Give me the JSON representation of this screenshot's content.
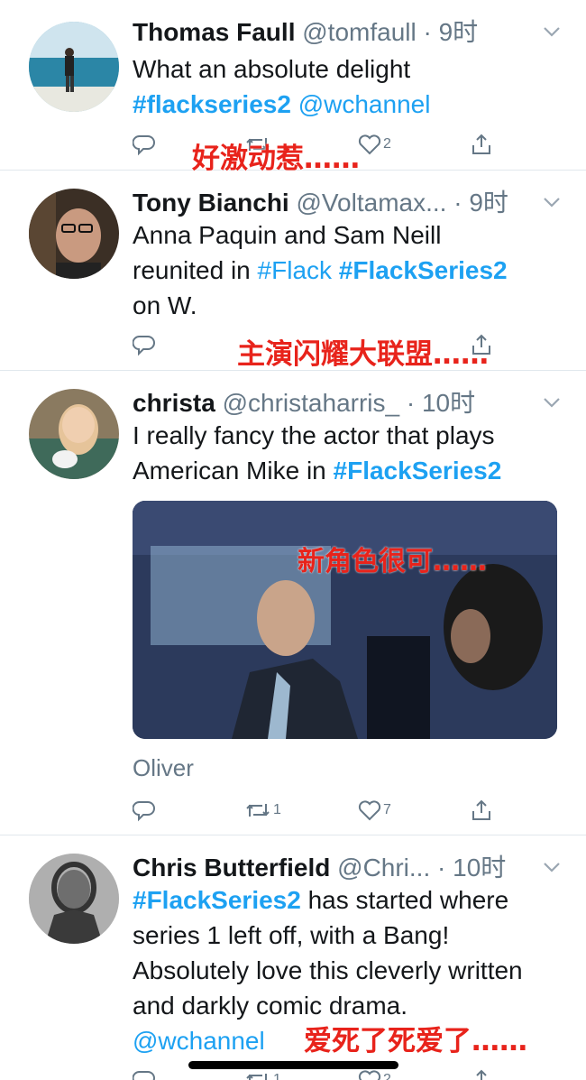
{
  "tweets": [
    {
      "name": "Thomas Faull",
      "handle": "@tomfaull",
      "sep": "·",
      "time": "9时",
      "body_text": "What an absolute delight",
      "tags": [
        "#flackseries2",
        "@wchannel"
      ],
      "actions": {
        "reply": "",
        "retweet": "",
        "like": "2"
      },
      "overlay": "好激动惹……"
    },
    {
      "name": "Tony Bianchi",
      "handle": "@Voltamax...",
      "sep": "·",
      "time": "9时",
      "body_line1": "Anna Paquin and Sam Neill",
      "body_line2_prefix": "reunited in ",
      "tags": [
        "#Flack",
        "#FlackSeries2"
      ],
      "body_line3": "on W.",
      "overlay": "主演闪耀大联盟……"
    },
    {
      "name": "christa",
      "handle": "@christaharris_",
      "sep": "·",
      "time": "10时",
      "body_line1": "I really fancy the actor that plays",
      "body_line2_prefix": "American Mike in ",
      "tags": [
        "#FlackSeries2"
      ],
      "media_overlay": "新角色很可……",
      "attribution": "Oliver",
      "actions": {
        "reply": "",
        "retweet": "1",
        "like": "7"
      }
    },
    {
      "name": "Chris Butterfield",
      "handle": "@Chri...",
      "sep": "·",
      "time": "10时",
      "tags": [
        "#FlackSeries2",
        "@wchannel"
      ],
      "body_line1_suffix": " has started where",
      "body_line2": "series 1 left off, with a Bang!",
      "body_line3": "Absolutely love this cleverly written",
      "body_line4": "and darkly comic drama.",
      "overlay": "爱死了死爱了……",
      "actions": {
        "retweet": "1",
        "like": "2"
      }
    }
  ],
  "icons": [
    "reply-icon",
    "retweet-icon",
    "like-icon",
    "share-icon",
    "chevron-down-icon"
  ],
  "colors": {
    "link": "#1da1f2",
    "muted": "#657786",
    "overlay": "#e8231b",
    "divider": "#e1e8ed"
  }
}
